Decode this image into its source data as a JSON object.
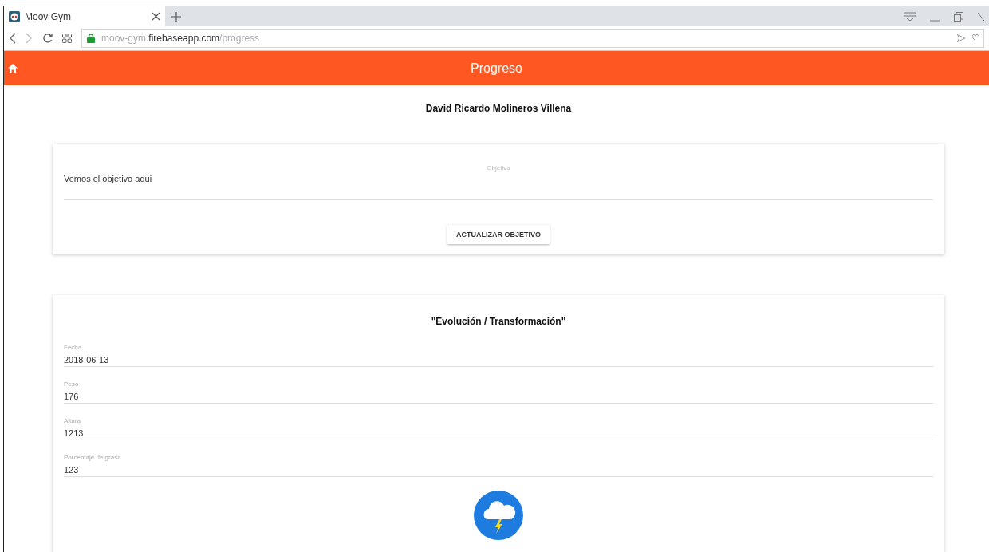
{
  "browser": {
    "tab": {
      "title": "Moov Gym",
      "selected": true
    },
    "url_parts": [
      {
        "text": "moov-gym.",
        "highlight": false
      },
      {
        "text": "firebaseapp.com",
        "highlight": true
      },
      {
        "text": "/progress",
        "highlight": false
      }
    ]
  },
  "app_bar": {
    "title": "Progreso"
  },
  "user_name": "David Ricardo Molineros Villena",
  "goal_card": {
    "label": "Objetivo",
    "value": "Vemos el objetivo aqui",
    "button": "ACTUALIZAR OBJETIVO"
  },
  "progress_card": {
    "title": "\"Evolución / Transformación\"",
    "fields": [
      {
        "label": "Fecha",
        "value": "2018-06-13"
      },
      {
        "label": "Peso",
        "value": "176"
      },
      {
        "label": "Altura",
        "value": "1213"
      },
      {
        "label": "Porcentaje de grasa",
        "value": "123"
      }
    ]
  }
}
